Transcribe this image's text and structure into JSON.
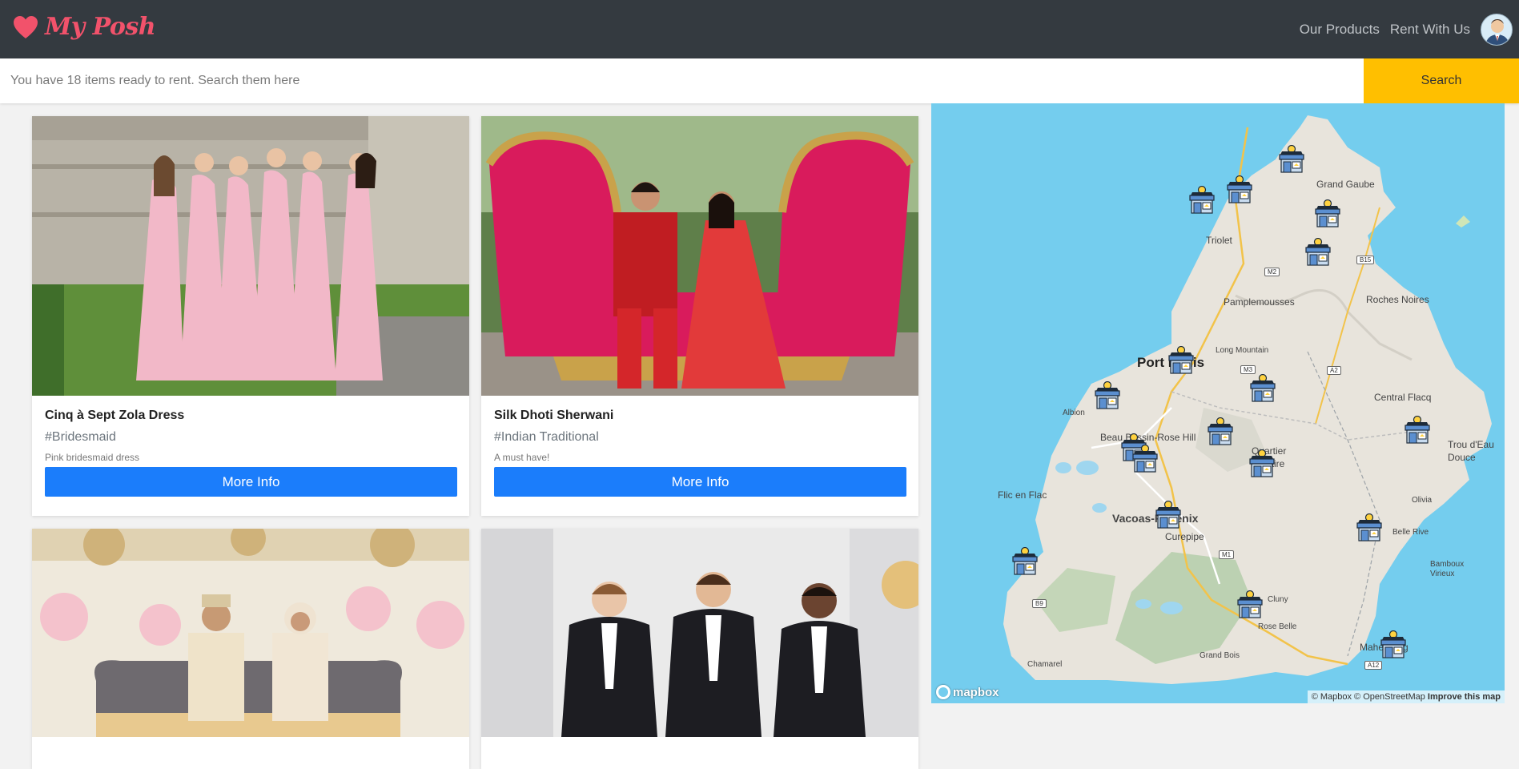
{
  "header": {
    "brand": "My Posh",
    "nav": [
      "Our Products",
      "Rent With Us"
    ]
  },
  "search": {
    "placeholder": "You have 18 items ready to rent. Search them here",
    "button_label": "Search"
  },
  "products": [
    {
      "title": "Cinq à Sept Zola Dress",
      "tag": "#Bridesmaid",
      "description": "Pink bridesmaid dress",
      "button": "More Info"
    },
    {
      "title": "Silk Dhoti Sherwani",
      "tag": "#Indian Traditional",
      "description": "A must have!",
      "button": "More Info"
    }
  ],
  "map": {
    "places": [
      "Grand Gaube",
      "Triolet",
      "Pamplemousses",
      "Roches Noires",
      "Long Mountain",
      "Port Louis",
      "Albion",
      "Central Flacq",
      "Trou d'Eau Douce",
      "Beau Bassin-Rose Hill",
      "Quartier Militaire",
      "Flic en Flac",
      "Olivia",
      "Vacoas-Phoenix",
      "Curepipe",
      "Belle Rive",
      "Bamboux Virieux",
      "Cluny",
      "Rose Belle",
      "Chamarel",
      "Grand Bois",
      "Mahebourg"
    ],
    "roads": [
      "M2",
      "B15",
      "M3",
      "A2",
      "M1",
      "B9",
      "A12"
    ],
    "logo": "mapbox",
    "attribution": "© Mapbox © OpenStreetMap",
    "improve_link": "Improve this map"
  },
  "colors": {
    "header_bg": "#343a40",
    "brand": "#f2526b",
    "search_button": "#ffbf00",
    "card_button": "#1b7dfb",
    "water": "#74cdee"
  }
}
